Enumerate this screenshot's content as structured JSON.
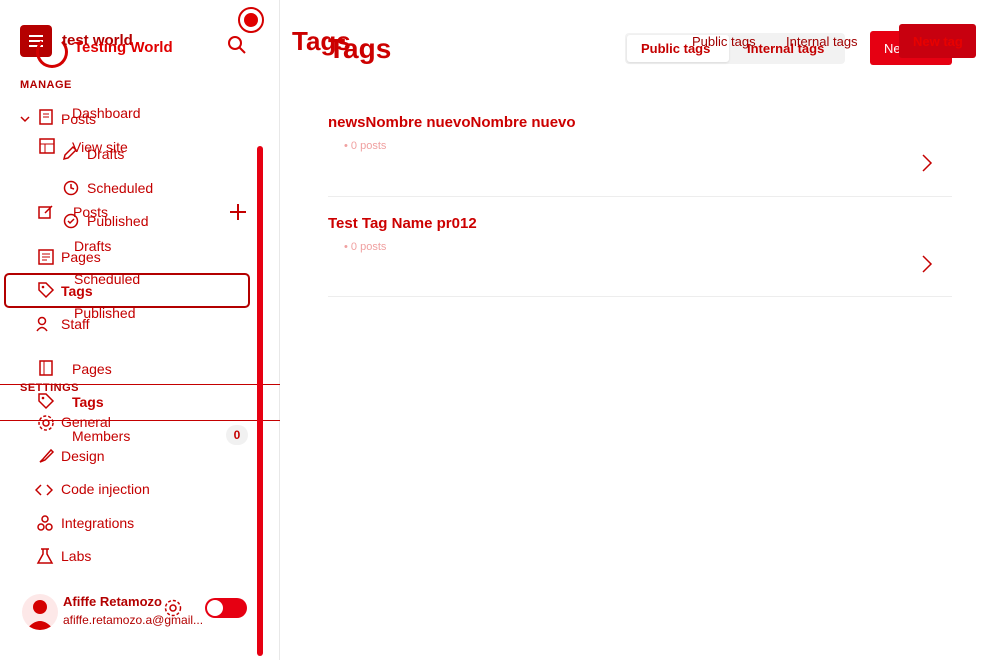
{
  "app": {
    "site_title": "test world",
    "site_title_overlay": "Testing World"
  },
  "sidebar": {
    "manage_heading": "MANAGE",
    "settings_heading": "SETTINGS",
    "items": {
      "posts": "Posts",
      "drafts": "Drafts",
      "scheduled": "Scheduled",
      "published": "Published",
      "pages": "Pages",
      "tags": "Tags",
      "staff": "Staff",
      "general": "General",
      "design": "Design",
      "code_injection": "Code injection",
      "integrations": "Integrations",
      "labs": "Labs"
    },
    "overlay_items": {
      "dashboard": "Dashboard",
      "view_site": "View site",
      "posts": "Posts",
      "drafts": "Drafts",
      "scheduled": "Scheduled",
      "published": "Published",
      "pages": "Pages",
      "tags": "Tags",
      "members": "Members",
      "members_count": "0"
    },
    "user": {
      "name": "Afiffe Retamozo",
      "email": "afiffe.retamozo.a@gmail..."
    }
  },
  "main": {
    "title": "Tags",
    "title_overlay": "Tags",
    "tabs": {
      "public": "Public tags",
      "internal": "Internal tags"
    },
    "tabs_overlay": {
      "public": "Public tags",
      "internal": "Internal tags"
    },
    "new_tag": "New tag",
    "new_tag_overlay": "New tag",
    "tags": [
      {
        "name": "newsNombre nuevoNombre nuevo",
        "count": "• 0 posts"
      },
      {
        "name": "Test Tag Name pr012",
        "count": "• 0 posts"
      }
    ]
  },
  "colors": {
    "accent": "#e60012",
    "text": "#cc0000"
  }
}
